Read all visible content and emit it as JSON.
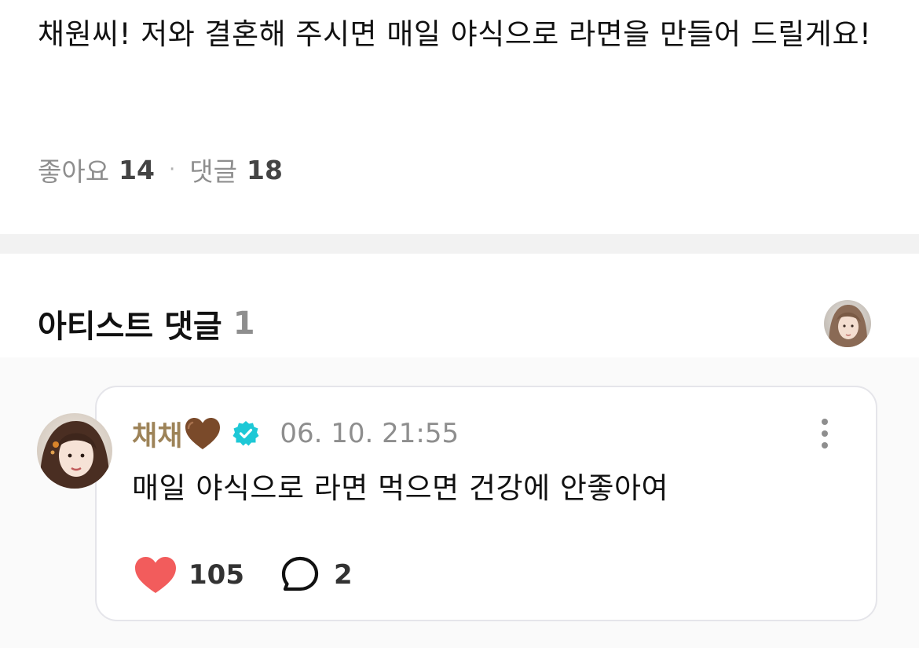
{
  "post": {
    "text": "채원씨! 저와 결혼해 주시면 매일 야식으로 라면을 만들어 드릴게요!",
    "likes_label": "좋아요",
    "likes_count": "14",
    "separator": "·",
    "comments_label": "댓글",
    "comments_count": "18"
  },
  "artist_comments": {
    "title": "아티스트 댓글",
    "count": "1"
  },
  "comment": {
    "author": "채채",
    "timestamp": "06. 10. 21:55",
    "text": "매일 야식으로 라면 먹으면 건강에 안좋아여",
    "like_count": "105",
    "reply_count": "2"
  },
  "icons": {
    "author_emoji": "brown-heart-icon",
    "verified": "verified-badge-icon",
    "more": "more-vertical-icon",
    "like": "heart-icon",
    "reply": "reply-bubble-icon"
  },
  "colors": {
    "author": "#9d8358",
    "verified": "#1ec8d6",
    "like": "#f25c5c",
    "brown_heart": "#7a4a2a",
    "muted": "#8e8e8e",
    "divider": "#f2f2f2"
  }
}
